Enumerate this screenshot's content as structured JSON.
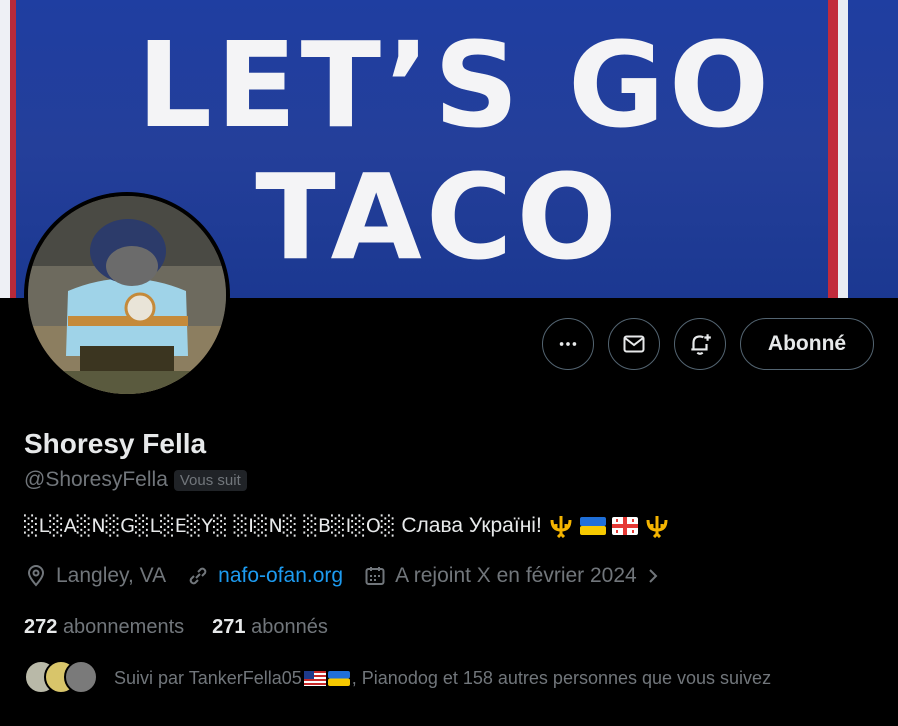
{
  "banner": {
    "line1": "LET’S GO",
    "line2": "TACO"
  },
  "actions": {
    "follow_label": "Abonné"
  },
  "profile": {
    "name": "Shoresy Fella",
    "handle": "@ShoresyFella",
    "follows_you_badge": "Vous suit",
    "bio_boxed": "░L░A░N░G░L░E░Y░ ░I░N░ ░B░I░O░",
    "bio_text": "Слава Україні!",
    "location": "Langley, VA",
    "website": "nafo-ofan.org",
    "joined": "A rejoint X en février 2024"
  },
  "stats": {
    "following_count": "272",
    "following_label": "abonnements",
    "followers_count": "271",
    "followers_label": "abonnés"
  },
  "followed_by": {
    "prefix": "Suivi par TankerFella05",
    "rest": ", Pianodog et 158 autres personnes que vous suivez"
  },
  "colors": {
    "link": "#1d9bf0",
    "muted": "#71767b",
    "text": "#e7e9ea",
    "border": "#536471"
  }
}
